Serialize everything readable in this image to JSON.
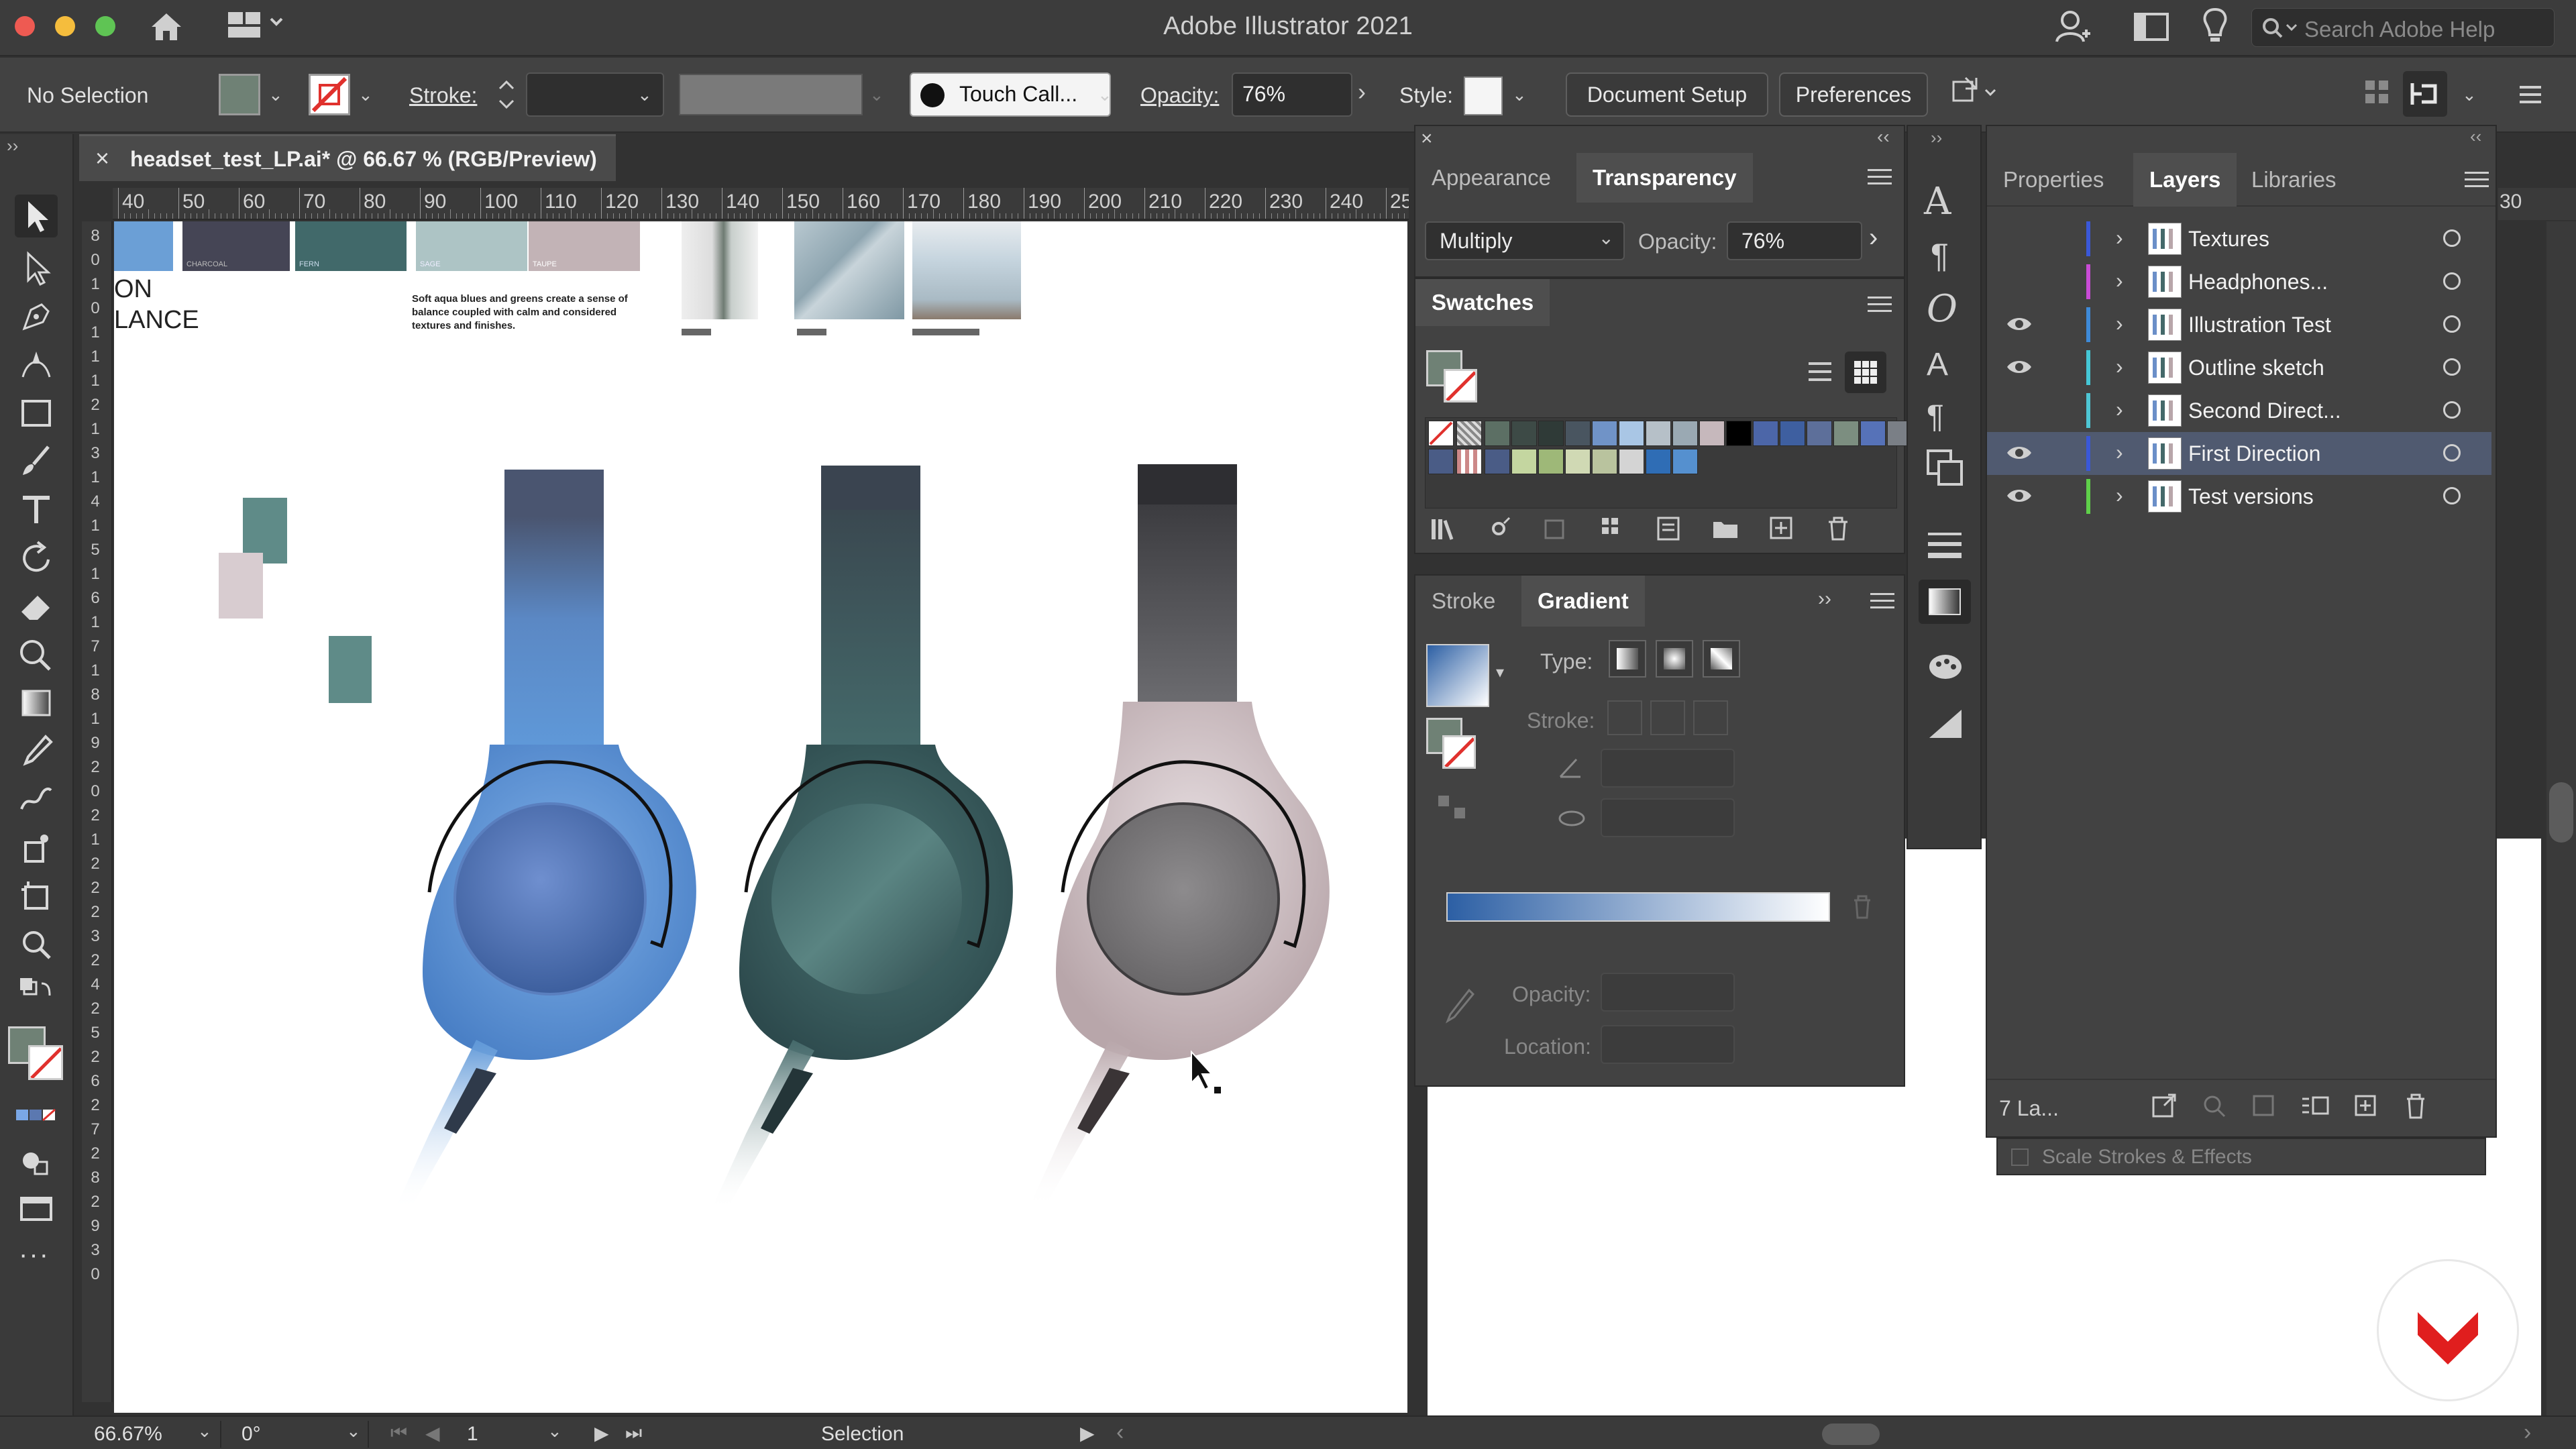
{
  "window": {
    "title": "Adobe Illustrator 2021",
    "search_placeholder": "Search Adobe Help"
  },
  "control_bar": {
    "selection_label": "No Selection",
    "stroke_label": "Stroke:",
    "brush_name": "Touch Call...",
    "opacity_label": "Opacity:",
    "opacity_value": "76%",
    "style_label": "Style:",
    "document_setup": "Document Setup",
    "preferences": "Preferences"
  },
  "document": {
    "tab_title": "headset_test_LP.ai* @ 66.67 % (RGB/Preview)"
  },
  "rulers": {
    "horizontal": [
      "40",
      "50",
      "60",
      "70",
      "80",
      "90",
      "100",
      "110",
      "120",
      "130",
      "140",
      "150",
      "160",
      "170",
      "180",
      "190",
      "200",
      "210",
      "220",
      "230",
      "240",
      "25"
    ],
    "vertical": [
      "8",
      "0",
      "1",
      "0",
      "1",
      "1",
      "1",
      "2",
      "1",
      "3",
      "1",
      "4",
      "1",
      "5",
      "1",
      "6",
      "1",
      "7",
      "1",
      "8",
      "1",
      "9",
      "2",
      "0",
      "2",
      "1",
      "2",
      "2",
      "2",
      "3",
      "2",
      "4",
      "2",
      "5",
      "2",
      "6",
      "2",
      "7",
      "2",
      "8",
      "2",
      "9",
      "3",
      "0"
    ],
    "right_fragment": "30"
  },
  "artboard": {
    "text_top_left": [
      "ON",
      "LANCE"
    ],
    "swatch_captions": [
      "CHARCOAL",
      "FERN",
      "SAGE",
      "TAUPE"
    ],
    "mood_text": "Soft aqua blues and greens create a sense of balance coupled with calm and considered textures and finishes.",
    "headphone_colors": {
      "blue": "#5b8fd0",
      "green": "#44696a",
      "taupe": "#c9b9bb"
    }
  },
  "transparency_panel": {
    "tabs": [
      "Appearance",
      "Transparency"
    ],
    "active_tab": "Transparency",
    "blend_mode": "Multiply",
    "opacity_label": "Opacity:",
    "opacity_value": "76%"
  },
  "swatches_panel": {
    "title": "Swatches",
    "colors": [
      "#5c6f64",
      "#3d4a46",
      "#2f3a37",
      "#495560",
      "#7093c7",
      "#a9c6e5",
      "#b6c0c8",
      "#9aa9b3",
      "#c6b8bc",
      "#000000",
      "#4c66a8",
      "#3e5fa0",
      "#5d6f9a",
      "#7c8e80",
      "#5672b8",
      "#7a7f86"
    ],
    "colors_row2": [
      "#4a5c86",
      "#c4d6a0",
      "#9eb878",
      "#d0d9b4",
      "#b9c39e",
      "#d4d4d4",
      "#2f6db5",
      "#5590cf"
    ]
  },
  "gradient_panel": {
    "tabs": [
      "Stroke",
      "Gradient"
    ],
    "active_tab": "Gradient",
    "type_label": "Type:",
    "stroke_label": "Stroke:",
    "opacity_label": "Opacity:",
    "location_label": "Location:",
    "gradient_start": "#2c5fa4",
    "gradient_end": "#ffffff"
  },
  "layers_panel": {
    "tabs": [
      "Properties",
      "Layers",
      "Libraries"
    ],
    "active_tab": "Layers",
    "layers": [
      {
        "name": "Textures",
        "color": "#3a58d8",
        "visible": false,
        "selected": false
      },
      {
        "name": "Headphones...",
        "color": "#c94cd6",
        "visible": false,
        "selected": false
      },
      {
        "name": "Illustration Test",
        "color": "#3e8ad8",
        "visible": true,
        "selected": false
      },
      {
        "name": "Outline sketch",
        "color": "#45c7d6",
        "visible": true,
        "selected": false
      },
      {
        "name": "Second Direct...",
        "color": "#4ec6d4",
        "visible": false,
        "selected": false
      },
      {
        "name": "First Direction",
        "color": "#3a58d8",
        "visible": true,
        "selected": true
      },
      {
        "name": "Test versions",
        "color": "#5fd04a",
        "visible": true,
        "selected": false
      }
    ],
    "footer_count": "7 La...",
    "scale_strokes": "Scale Strokes & Effects"
  },
  "status_bar": {
    "zoom": "66.67%",
    "rotation": "0°",
    "artboard_number": "1",
    "tool_name": "Selection"
  }
}
